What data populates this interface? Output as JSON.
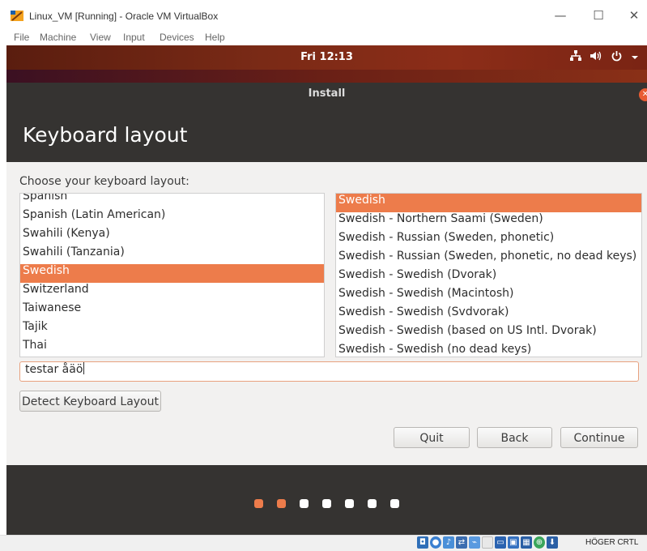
{
  "window": {
    "title": "Linux_VM [Running] - Oracle VM VirtualBox",
    "controls": {
      "minimize": "—",
      "maximize": "☐",
      "close": "✕"
    }
  },
  "menubar": [
    "File",
    "Machine",
    "View",
    "Input",
    "Devices",
    "Help"
  ],
  "guest_panel": {
    "clock": "Fri 12:13",
    "icons": [
      "network-icon",
      "volume-icon",
      "power-icon",
      "chevron-down-icon"
    ]
  },
  "installer": {
    "window_title": "Install",
    "heading": "Keyboard layout",
    "choose_label": "Choose your keyboard layout:",
    "layouts": [
      "Spanish",
      "Spanish (Latin American)",
      "Swahili (Kenya)",
      "Swahili (Tanzania)",
      "Swedish",
      "Switzerland",
      "Taiwanese",
      "Tajik",
      "Thai"
    ],
    "selected_layout": "Swedish",
    "variants": [
      "Swedish",
      "Swedish - Northern Saami (Sweden)",
      "Swedish - Russian (Sweden, phonetic)",
      "Swedish - Russian (Sweden, phonetic, no dead keys)",
      "Swedish - Swedish (Dvorak)",
      "Swedish - Swedish (Macintosh)",
      "Swedish - Swedish (Svdvorak)",
      "Swedish - Swedish (based on US Intl. Dvorak)",
      "Swedish - Swedish (no dead keys)"
    ],
    "selected_variant": "Swedish",
    "test_input_value": "testar åäö",
    "detect_button": "Detect Keyboard Layout",
    "quit_button": "Quit",
    "back_button": "Back",
    "continue_button": "Continue",
    "progress": {
      "total_steps": 7,
      "completed_steps": 2
    }
  },
  "statusbar": {
    "host_key": "HÖGER CRTL"
  },
  "colors": {
    "accent": "#ed7c4b",
    "header_bg": "#353331"
  }
}
